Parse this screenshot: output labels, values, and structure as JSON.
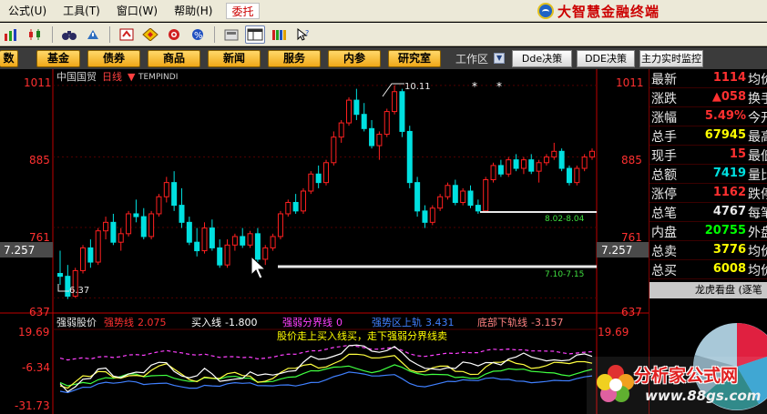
{
  "menu": {
    "items": [
      "公式(U)",
      "工具(T)",
      "窗口(W)",
      "帮助(H)"
    ],
    "entrust": "委托",
    "brand": "大智慧金融终端"
  },
  "toolbar": {
    "icons": [
      "bar-chart-icon",
      "kline-icon",
      "binoculars-icon",
      "alert-icon",
      "refresh-icon",
      "diamond-icon",
      "radar-icon",
      "percent-icon",
      "calculator-icon",
      "layout-icon",
      "books-icon",
      "cursor-help-icon"
    ]
  },
  "navbar": {
    "buttons": [
      "数",
      "基金",
      "债券",
      "商品",
      "新闻",
      "服务",
      "内参",
      "研究室"
    ],
    "workspace_label": "工作区",
    "right_buttons": [
      "Dde决策",
      "DDE决策",
      "主力实时监控"
    ]
  },
  "chart": {
    "stock_name": "中国国贸",
    "period": "日线",
    "indicator_name": "TEMPINDI",
    "price_labels": [
      "1011",
      "885",
      "761",
      "637"
    ],
    "current_price": "7.257",
    "peak_annotation": "10.11",
    "low_annotation": "6.37",
    "band_upper": "8.02-8.04",
    "band_lower": "7.10-7.15",
    "sub_price_labels": [
      "19.69",
      "-6.34",
      "-31.73"
    ],
    "colors": {
      "up": "#ff2020",
      "down": "#00e0e0",
      "axis": "#c00000"
    }
  },
  "chart_data": {
    "type": "candlestick",
    "title": "中国国贸 日线",
    "y_label_values": [
      10.11,
      8.85,
      7.61,
      6.37
    ],
    "ohlc": [
      [
        6.8,
        7.2,
        6.6,
        6.75
      ],
      [
        6.75,
        6.95,
        6.35,
        6.4
      ],
      [
        6.4,
        6.9,
        6.37,
        6.85
      ],
      [
        6.85,
        7.3,
        6.8,
        7.25
      ],
      [
        7.25,
        7.4,
        6.9,
        7.0
      ],
      [
        7.0,
        7.6,
        6.95,
        7.55
      ],
      [
        7.55,
        7.8,
        7.4,
        7.7
      ],
      [
        7.7,
        7.85,
        7.3,
        7.35
      ],
      [
        7.35,
        7.6,
        7.2,
        7.5
      ],
      [
        7.5,
        7.9,
        7.45,
        7.85
      ],
      [
        7.85,
        8.1,
        7.7,
        7.8
      ],
      [
        7.8,
        7.95,
        7.4,
        7.45
      ],
      [
        7.45,
        7.9,
        7.4,
        7.85
      ],
      [
        7.85,
        8.2,
        7.8,
        8.15
      ],
      [
        8.15,
        8.5,
        8.05,
        8.4
      ],
      [
        8.4,
        8.6,
        7.9,
        8.0
      ],
      [
        8.0,
        8.3,
        7.6,
        7.7
      ],
      [
        7.7,
        7.8,
        7.3,
        7.35
      ],
      [
        7.35,
        7.6,
        7.1,
        7.2
      ],
      [
        7.2,
        7.7,
        7.15,
        7.6
      ],
      [
        7.6,
        7.75,
        7.2,
        7.25
      ],
      [
        7.25,
        7.4,
        6.9,
        6.95
      ],
      [
        6.95,
        7.4,
        6.9,
        7.3
      ],
      [
        7.3,
        7.5,
        7.2,
        7.45
      ],
      [
        7.45,
        7.6,
        7.25,
        7.3
      ],
      [
        7.3,
        7.55,
        7.25,
        7.5
      ],
      [
        7.5,
        7.6,
        7.0,
        7.05
      ],
      [
        7.05,
        7.3,
        6.95,
        7.25
      ],
      [
        7.25,
        7.5,
        7.2,
        7.45
      ],
      [
        7.45,
        7.9,
        7.4,
        7.85
      ],
      [
        7.85,
        8.1,
        7.8,
        8.05
      ],
      [
        8.05,
        8.2,
        7.85,
        7.9
      ],
      [
        7.9,
        8.3,
        7.85,
        8.25
      ],
      [
        8.25,
        8.6,
        8.2,
        8.55
      ],
      [
        8.55,
        8.7,
        8.3,
        8.4
      ],
      [
        8.4,
        8.8,
        8.35,
        8.75
      ],
      [
        8.75,
        9.3,
        8.7,
        9.2
      ],
      [
        9.2,
        9.5,
        9.1,
        9.45
      ],
      [
        9.45,
        9.9,
        9.4,
        9.85
      ],
      [
        9.85,
        10.05,
        9.5,
        9.6
      ],
      [
        9.6,
        9.8,
        9.3,
        9.35
      ],
      [
        9.35,
        9.5,
        9.0,
        9.05
      ],
      [
        9.05,
        9.3,
        8.8,
        9.25
      ],
      [
        9.25,
        9.7,
        9.2,
        9.65
      ],
      [
        9.65,
        10.11,
        9.6,
        10.0
      ],
      [
        10.0,
        10.05,
        9.2,
        9.3
      ],
      [
        9.3,
        9.4,
        8.3,
        8.4
      ],
      [
        8.4,
        8.5,
        7.8,
        7.9
      ],
      [
        7.9,
        8.0,
        7.6,
        7.7
      ],
      [
        7.7,
        8.0,
        7.65,
        7.95
      ],
      [
        7.95,
        8.2,
        7.9,
        8.15
      ],
      [
        8.15,
        8.4,
        8.1,
        8.35
      ],
      [
        8.35,
        8.45,
        8.0,
        8.05
      ],
      [
        8.05,
        8.3,
        8.0,
        8.25
      ],
      [
        8.25,
        8.35,
        7.95,
        8.0
      ],
      [
        8.0,
        8.1,
        7.85,
        7.9
      ],
      [
        7.9,
        8.5,
        7.88,
        8.45
      ],
      [
        8.45,
        8.75,
        8.4,
        8.7
      ],
      [
        8.7,
        8.8,
        8.5,
        8.55
      ],
      [
        8.55,
        8.85,
        8.5,
        8.8
      ],
      [
        8.8,
        8.9,
        8.6,
        8.65
      ],
      [
        8.65,
        8.85,
        8.55,
        8.8
      ],
      [
        8.8,
        8.9,
        8.55,
        8.6
      ],
      [
        8.6,
        8.8,
        8.4,
        8.75
      ],
      [
        8.75,
        8.9,
        8.7,
        8.85
      ],
      [
        8.85,
        9.1,
        8.8,
        8.95
      ],
      [
        8.95,
        9.0,
        8.6,
        8.65
      ],
      [
        8.65,
        8.7,
        8.35,
        8.4
      ],
      [
        8.4,
        8.7,
        8.35,
        8.65
      ],
      [
        8.65,
        8.9,
        8.6,
        8.85
      ],
      [
        8.85,
        9.0,
        8.8,
        8.95
      ]
    ],
    "band_upper": [
      8.02,
      8.04
    ],
    "band_lower": [
      7.1,
      7.15
    ],
    "y_range": [
      6.2,
      10.3
    ],
    "sub_indicator": {
      "name": "强弱股价",
      "params": [
        {
          "label": "强势线",
          "value": "2.075"
        },
        {
          "label": "买入线",
          "value": "-1.800"
        },
        {
          "label": "强弱分界线",
          "value": "0"
        },
        {
          "label": "强势区上轨",
          "value": "3.431"
        },
        {
          "label": "底部下轨线",
          "value": "-3.157"
        }
      ],
      "signal_text": "股价走上买入线买，走下强弱分界线卖",
      "y_label_values": [
        19.69,
        -6.34,
        -31.73
      ]
    }
  },
  "quotes": {
    "rows": [
      {
        "label": "最新",
        "value": "1114",
        "color": "#ff3030",
        "right": "均价"
      },
      {
        "label": "涨跌",
        "value": "▲058",
        "color": "#ff3030",
        "right": "换手"
      },
      {
        "label": "涨幅",
        "value": "5.49%",
        "color": "#ff3030",
        "right": "今开"
      },
      {
        "label": "总手",
        "value": "67945",
        "color": "#ffff00",
        "right": "最高"
      },
      {
        "label": "现手",
        "value": "15",
        "color": "#ff3030",
        "right": "最低"
      },
      {
        "label": "总额",
        "value": "7419",
        "color": "#00e0e0",
        "right": "量比"
      },
      {
        "label": "涨停",
        "value": "1162",
        "color": "#ff3030",
        "right": "跌停"
      },
      {
        "label": "总笔",
        "value": "4767",
        "color": "#e8e8e8",
        "right": "每笔"
      },
      {
        "label": "内盘",
        "value": "20755",
        "color": "#00ff00",
        "right": "外盘"
      },
      {
        "label": "总卖",
        "value": "3776",
        "color": "#ffff00",
        "right": "均价"
      },
      {
        "label": "总买",
        "value": "6008",
        "color": "#ffff00",
        "right": "均价"
      }
    ],
    "lhk_label": "龙虎看盘 (逐笔"
  },
  "watermark": {
    "name": "分析家公式网",
    "url": "www.88gs.com"
  }
}
